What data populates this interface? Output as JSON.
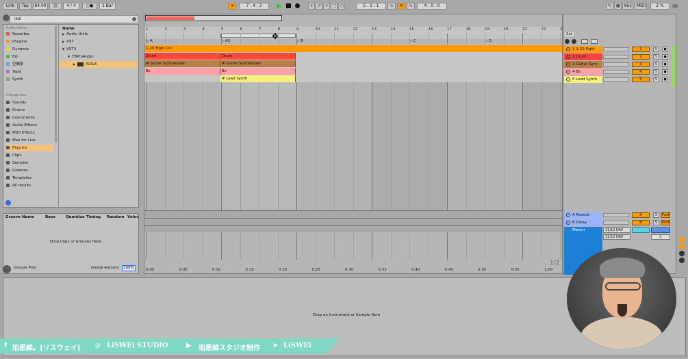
{
  "transport": {
    "link": "Link",
    "tap": "Tap",
    "tempo": "84.00",
    "signature": "4 / 4",
    "metro": "1 Bar",
    "position": "7 .  4 .  3",
    "loop_start": "5 .  1 .  1",
    "loop_length": "4 .  0 .  0",
    "key": "Key",
    "midi": "MIDI",
    "cpu": "2 %",
    "h": "H",
    "w": "W"
  },
  "browser": {
    "search_value": "isol",
    "collections_header": "Collections",
    "collections": [
      "Favorites",
      "iPlugins",
      "Dynamic",
      "EQ",
      "空間系",
      "Tape",
      "Synth"
    ],
    "collection_colors": [
      "#ff4d4d",
      "#ff9a00",
      "#f2d21b",
      "#42c142",
      "#3fb8e8",
      "#b46be0",
      "#9a9a9a"
    ],
    "categories_header": "Categories",
    "categories": [
      "Sounds",
      "Drums",
      "Instruments",
      "Audio Effects",
      "MIDI Effects",
      "Max for Live",
      "Plug-ins",
      "Clips",
      "Samples",
      "Grooves",
      "Templates",
      "All results"
    ],
    "selected_category": "Plug-ins",
    "tree_header": "Name",
    "tree": [
      "Audio Units",
      "VST",
      "VST3",
      "TBProAudio",
      "ISOL8"
    ]
  },
  "groove": {
    "columns": [
      "Groove Name",
      "Base",
      "Quantize",
      "Timing",
      "Random",
      "Veloc"
    ],
    "empty_text": "Drop Clips or Grooves Here",
    "pool_label": "Groove Pool",
    "global_amount_label": "Global Amount",
    "global_amount_value": "100%"
  },
  "arrangement": {
    "bar_numbers": [
      "1",
      "2",
      "3",
      "4",
      "5",
      "6",
      "7",
      "8",
      "9",
      "10",
      "11",
      "12",
      "13",
      "14",
      "15",
      "16",
      "17",
      "18",
      "19",
      "20",
      "21",
      "22",
      "23"
    ],
    "locators": [
      "A",
      "A2",
      "B",
      "C",
      "D"
    ],
    "clips": {
      "track1": [
        "1-20 Fight On!"
      ],
      "track2": [
        "Drum",
        "Drum"
      ],
      "track3": [
        "# Guitar Synthesizer",
        "# Guitar Synthesizer"
      ],
      "track4": [
        "Bs",
        "Bs"
      ],
      "track5": [
        "# Lead Synth"
      ]
    },
    "time_ruler": [
      "0:00",
      "0:05",
      "0:10",
      "0:15",
      "0:20",
      "0:25",
      "0:30",
      "0:35",
      "0:40",
      "0:45",
      "0:50",
      "0:55",
      "1:00"
    ],
    "page": "1/2"
  },
  "mixer": {
    "set_label": "Set",
    "tracks": [
      {
        "name": "1 1-20 Fight",
        "num": "1",
        "color": "#ff9a00"
      },
      {
        "name": "2 Drum",
        "num": "2",
        "color": "#ff4040"
      },
      {
        "name": "3 Guitar Synt",
        "num": "3",
        "color": "#b57e45"
      },
      {
        "name": "4 Bs",
        "num": "4",
        "color": "#ff9fa8"
      },
      {
        "name": "5 Lead Synth",
        "num": "5",
        "color": "#f7f07a"
      }
    ],
    "returns": [
      {
        "name": "A Reverb",
        "num": "A"
      },
      {
        "name": "B Delay",
        "num": "B"
      }
    ],
    "master": {
      "name": "Master",
      "in1": "11/12 DAV",
      "in2": "11/12 DAV",
      "cue": "C",
      "post": "Post",
      "solo": "S"
    }
  },
  "detail": {
    "empty_text": "Drop an Instrument or Sample Here"
  },
  "banner": {
    "t1": "珀思維。[リスウェイ]",
    "t2": "LiSWEi STUDIO",
    "t3": "珀思維スタジオ制作",
    "t4": "LiSWEi"
  }
}
